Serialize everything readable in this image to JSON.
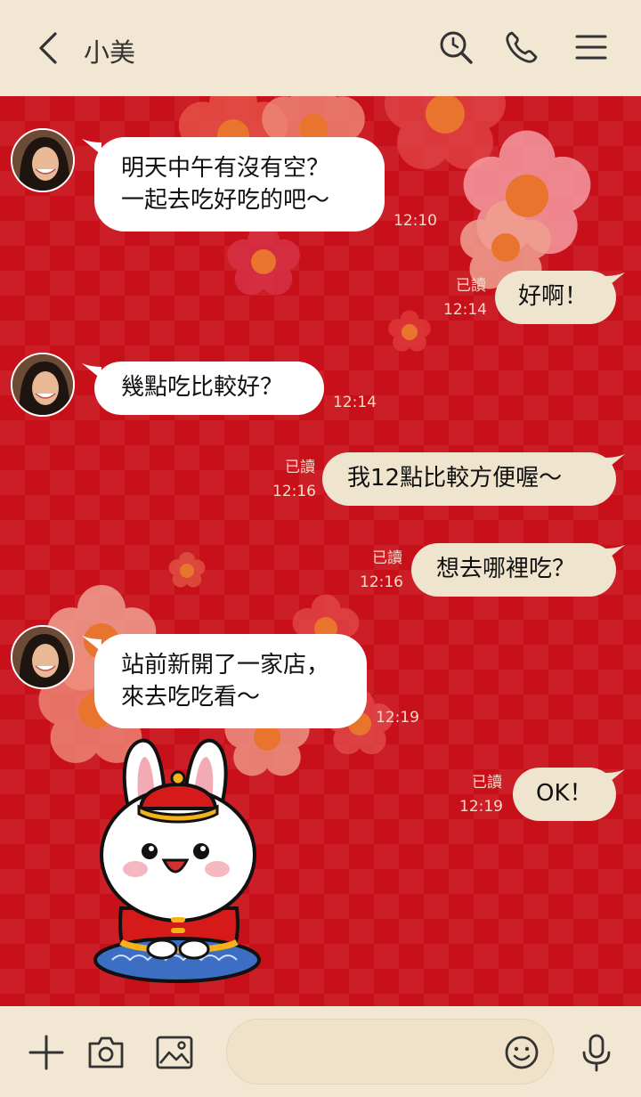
{
  "header": {
    "title": "小美",
    "icons": [
      "back-chevron-icon",
      "search-icon",
      "phone-icon",
      "menu-icon"
    ]
  },
  "colors": {
    "header_bg": "#f1e7d3",
    "chat_bg": "#c8101a",
    "incoming_bubble": "#ffffff",
    "outgoing_bubble": "#efe4cd"
  },
  "messages": [
    {
      "from": "other",
      "text": "明天中午有沒有空？\n一起去吃好吃的吧～",
      "time": "12:10"
    },
    {
      "from": "me",
      "text": "好啊！",
      "read": "已讀",
      "time": "12:14"
    },
    {
      "from": "other",
      "text": "幾點吃比較好？",
      "time": "12:14"
    },
    {
      "from": "me",
      "text": "我12點比較方便喔～",
      "read": "已讀",
      "time": "12:16"
    },
    {
      "from": "me",
      "text": "想去哪裡吃？",
      "read": "已讀",
      "time": "12:16"
    },
    {
      "from": "other",
      "text": "站前新開了一家店，\n來去吃吃看～",
      "time": "12:19"
    },
    {
      "from": "me",
      "text": "OK！",
      "read": "已讀",
      "time": "12:19"
    }
  ],
  "footer": {
    "input_value": "",
    "icons": [
      "plus-icon",
      "camera-icon",
      "image-icon",
      "emoji-icon",
      "microphone-icon"
    ]
  }
}
